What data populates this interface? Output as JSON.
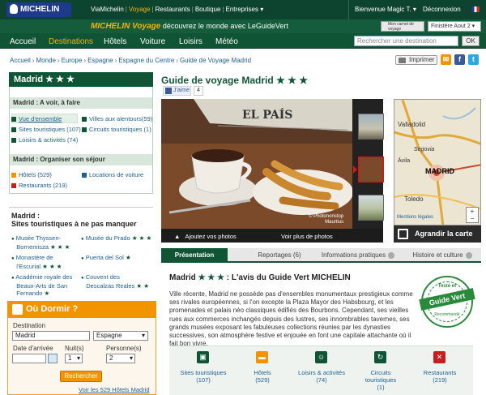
{
  "header": {
    "logo_text": "MICHELIN",
    "links": [
      "ViaMichelin",
      "Voyage",
      "Restaurants",
      "Boutique",
      "Entreprises ▾"
    ],
    "welcome": "Bienvenue Magic T. ▾",
    "logout": "Déconnexion"
  },
  "tagline": {
    "brand": "MICHELIN Voyage",
    "text": "découvrez le monde avec LeGuideVert"
  },
  "carnet": {
    "label": "Mon carnet de voyage"
  },
  "itinerary": {
    "value": "Finistère Aout 2 ▾"
  },
  "nav": {
    "items": [
      "Accueil",
      "Destinations",
      "Hôtels",
      "Voiture",
      "Loisirs",
      "Météo"
    ],
    "search_placeholder": "Rechercher une destination",
    "ok": "OK"
  },
  "breadcrumb": [
    "Accueil",
    "Monde",
    "Europe",
    "Espagne",
    "Espagne du Centre",
    "Guide de Voyage Madrid"
  ],
  "print_label": "Imprimer",
  "left": {
    "city": "Madrid ★ ★ ★",
    "section1": "Madrid : A voir, à faire",
    "items1": [
      "Vue d'ensemble",
      "Villes aux alentours(59)",
      "Sites touristiques (107)",
      "Circuits touristiques (1)",
      "Loisirs & activités (74)"
    ],
    "section2": "Madrid : Organiser son séjour",
    "items2": [
      "Hôtels (529)",
      "Locations de voiture",
      "Restaurants (219)"
    ],
    "sites_title_1": "Madrid :",
    "sites_title_2": "Sites touristiques à ne pas manquer",
    "sites": [
      {
        "l1": "Musée Thyssen-",
        "l2": "Bornemisza",
        "stars": "★ ★ ★"
      },
      {
        "l1": "Musée du Prado",
        "l2": "",
        "stars": "★ ★ ★"
      },
      {
        "l1": "Monastère de",
        "l2": "l'Escurial",
        "stars": "★ ★ ★"
      },
      {
        "l1": "Puerta del Sol",
        "l2": "",
        "stars": "★"
      },
      {
        "l1": "Académie royale des",
        "l2": "Beaux-Arts de San",
        "l3": "Fernando",
        "stars": "★"
      },
      {
        "l1": "Couvent des",
        "l2": "Descalzas Reales",
        "stars": "★ ★"
      }
    ]
  },
  "dormir": {
    "title": "Où Dormir ?",
    "dest_label": "Destination",
    "dest_value": "Madrid",
    "country_value": "Espagne",
    "arrival_label": "Date d'arrivée",
    "nights_label": "Nuit(s)",
    "nights_value": "1",
    "persons_label": "Personne(s)",
    "persons_value": "2",
    "button": "Rechercher",
    "all_link": "Voir les 529 Hôtels Madrid"
  },
  "main": {
    "title": "Guide de voyage Madrid ★ ★ ★",
    "like": "J'aime",
    "like_count": "4",
    "photo_credit_1": "© Photononstop",
    "photo_credit_2": "Maurtius",
    "add_photos": "Ajoutez vos photos",
    "more_photos": "Voir plus de photos",
    "map_labels": [
      "Valladolid",
      "Segovia",
      "Ávila",
      "MADRID",
      "Toledo"
    ],
    "map_legal": "Mentions légales",
    "enlarge": "Agrandir la carte"
  },
  "tabs": [
    "Présentation",
    "Reportages (6)",
    "Informations pratiques",
    "Histoire et culture"
  ],
  "avis": {
    "title_prefix": "Madrid",
    "title_stars": "★ ★ ★",
    "title_suffix": ": L'avis du Guide Vert MICHELIN",
    "text": "Ville récente, Madrid ne possède pas d'ensembles monumentaux prestigieux comme ses rivales européennes, si l'on excepte la Plaza Mayor des Habsbourg, et les promenades et palais néo classiques édifiés des Bourbons. Cependant, ses vieilles rues aux commerces inchangés depuis des lustres, ses innombrables tavernes, ses grands musées exposant les fabuleuses collections réunies par les dynasties successives, son atmosphère festive et enjouée en font une capitale attachante où il fait bon vivre.",
    "badge_top": "Testé et",
    "badge_main": "Guide Vert",
    "badge_bot": "Recommandé"
  },
  "bottom_icons": [
    {
      "label_1": "Sites touristiques",
      "label_2": "(107)"
    },
    {
      "label_1": "Hôtels",
      "label_2": "(529)"
    },
    {
      "label_1": "Loisirs & activités",
      "label_2": "(74)"
    },
    {
      "label_1": "Circuits",
      "label_2": "touristiques",
      "label_3": "(1)"
    },
    {
      "label_1": "Restaurants",
      "label_2": "(219)"
    }
  ],
  "colors": {
    "brand_green": "#0f5535",
    "accent_yellow": "#f6b400",
    "orange": "#f29400",
    "link_blue": "#1e5f95"
  }
}
